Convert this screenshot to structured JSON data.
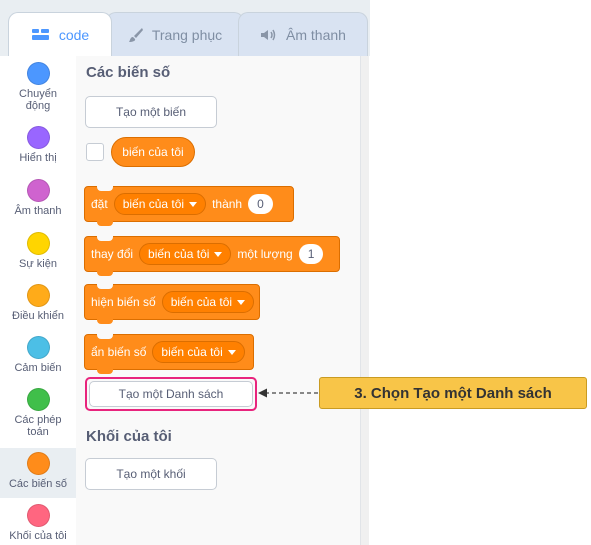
{
  "tabs": [
    {
      "label": "code",
      "icon": "code-icon",
      "active": true
    },
    {
      "label": "Trang phục",
      "icon": "brush-icon",
      "active": false
    },
    {
      "label": "Âm thanh",
      "icon": "speaker-icon",
      "active": false
    }
  ],
  "categories": [
    {
      "label": "Chuyển\nđộng",
      "color": "#4c97ff"
    },
    {
      "label": "Hiển thị",
      "color": "#9966ff"
    },
    {
      "label": "Âm thanh",
      "color": "#cf63cf"
    },
    {
      "label": "Sự kiện",
      "color": "#ffd500"
    },
    {
      "label": "Điều khiển",
      "color": "#ffab19"
    },
    {
      "label": "Cảm biến",
      "color": "#4cbfe6"
    },
    {
      "label": "Các phép\ntoán",
      "color": "#40bf4a"
    },
    {
      "label": "Các biến số",
      "color": "#ff8c1a"
    },
    {
      "label": "Khối của tôi",
      "color": "#ff6680"
    }
  ],
  "palette": {
    "variables_heading": "Các biến số",
    "make_variable_button": "Tạo một biến",
    "variable_reporter": "biến của tôi",
    "blocks": {
      "set": {
        "prefix": "đặt",
        "variable": "biến của tôi",
        "middle": "thành",
        "value": "0"
      },
      "change": {
        "prefix": "thay đổi",
        "variable": "biến của tôi",
        "middle": "một lượng",
        "value": "1"
      },
      "show": {
        "prefix": "hiện biến số",
        "variable": "biến của tôi"
      },
      "hide": {
        "prefix": "ẩn biến số",
        "variable": "biến của tôi"
      }
    },
    "make_list_button": "Tạo một Danh sách",
    "my_blocks_heading": "Khối của tôi",
    "make_block_button": "Tạo một khối"
  },
  "annotation": {
    "text": "3. Chọn Tạo một Danh sách",
    "highlight_color": "#e8247d",
    "callout_color": "#f8c548"
  }
}
